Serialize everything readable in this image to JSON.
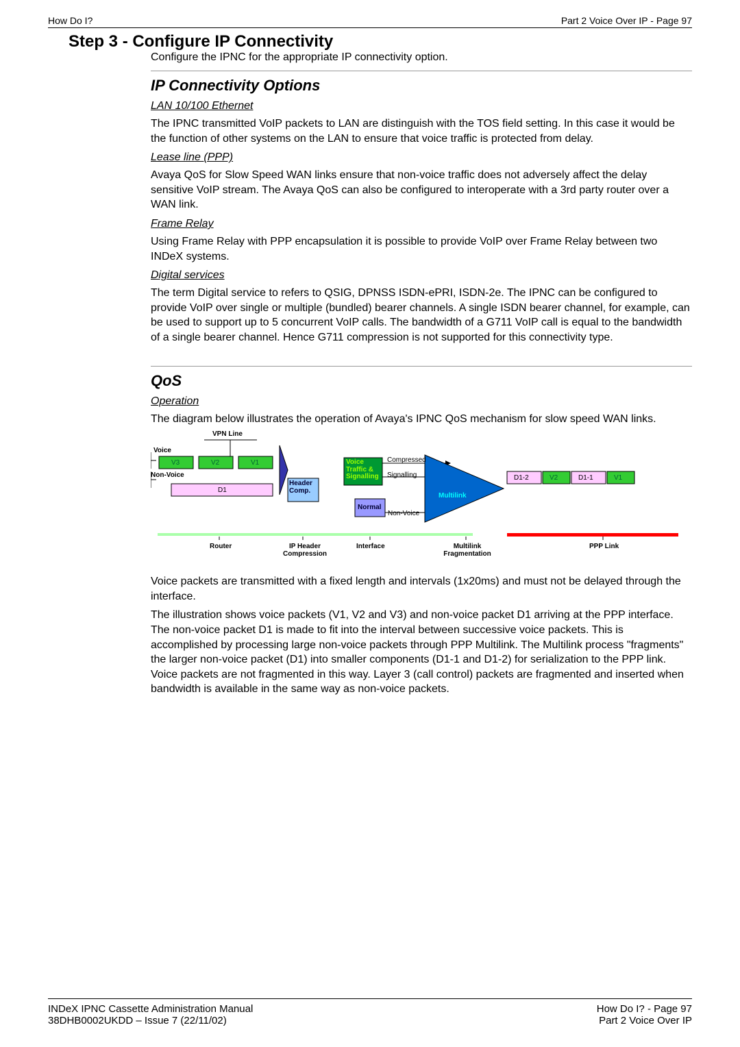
{
  "header": {
    "left": "How Do I?",
    "right": "Part 2 Voice Over IP - Page 97"
  },
  "step": {
    "title": "Step 3 - Configure IP Connectivity",
    "intro": "Configure the IPNC for the appropriate IP connectivity option."
  },
  "ipconn": {
    "heading": "IP Connectivity Options",
    "lan": {
      "title": "LAN 10/100 Ethernet",
      "body": "The IPNC transmitted VoIP packets to LAN are distinguish with the TOS field setting. In this case it would be the function of other systems on the LAN to ensure that voice traffic is protected from delay."
    },
    "lease": {
      "title": "Lease line (PPP)",
      "body": "Avaya QoS for Slow Speed WAN links ensure that non-voice traffic does not adversely affect the delay sensitive VoIP stream. The Avaya QoS can also be configured to interoperate with a 3rd party router over a WAN link."
    },
    "framerelay": {
      "title": "Frame Relay",
      "body": "Using Frame Relay with PPP encapsulation it is possible to provide VoIP over Frame Relay between two INDeX systems."
    },
    "digital": {
      "title": "Digital services",
      "body": "The term Digital service to refers to QSIG, DPNSS ISDN-ePRI, ISDN-2e. The IPNC can be configured to provide VoIP over single or multiple (bundled) bearer channels. A single ISDN bearer channel, for example, can be used to support up to 5 concurrent VoIP calls. The bandwidth of a G711 VoIP call is equal to the bandwidth of a single bearer channel. Hence G711 compression is not supported for this connectivity type."
    }
  },
  "qos": {
    "heading": "QoS",
    "operation_title": "Operation",
    "operation_intro": "The diagram below illustrates the operation of Avaya's IPNC QoS mechanism for slow speed WAN links.",
    "para1": "Voice packets are transmitted with a fixed length and intervals (1x20ms) and must not be delayed through the interface.",
    "para2": "The illustration shows voice packets (V1, V2 and V3) and non-voice packet D1 arriving at the PPP interface. The non-voice packet D1 is made to fit into the interval between successive voice packets. This is accomplished by processing large non-voice packets through PPP Multilink. The Multilink process \"fragments\" the larger non-voice packet (D1) into smaller components (D1-1 and D1-2) for serialization to the PPP link. Voice packets are not fragmented in this way. Layer 3 (call control) packets are fragmented and inserted when bandwidth is available in the same way as non-voice packets."
  },
  "diagram": {
    "vpn_line": "VPN Line",
    "voice": "Voice",
    "non_voice": "Non-Voice",
    "v3": "V3",
    "v2": "V2",
    "v1": "V1",
    "d1": "D1",
    "header_comp": "Header Comp.",
    "voice_traffic_sig": "Voice Traffic & Signalling",
    "normal": "Normal",
    "compressed": "Compressed",
    "signalling": "Signalling",
    "non_voice2": "Non-Voice",
    "multilink": "Multilink",
    "d1_2": "D1-2",
    "d1_1": "D1-1",
    "v2r": "V2",
    "v1r": "V1",
    "router": "Router",
    "ip_header_compression": "IP Header Compression",
    "interface": "Interface",
    "multilink_frag": "Multilink Fragmentation",
    "ppp_link": "PPP Link"
  },
  "footer": {
    "left1": "INDeX IPNC Cassette Administration Manual",
    "left2": "38DHB0002UKDD – Issue 7 (22/11/02)",
    "right1": "How Do I? - Page 97",
    "right2": "Part 2 Voice Over IP"
  }
}
